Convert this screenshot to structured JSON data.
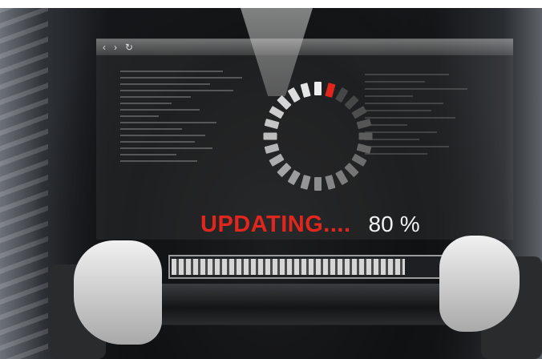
{
  "update_overlay": {
    "status_label": "UPDATING....",
    "progress_percent": 80,
    "progress_value_text": "80",
    "progress_unit": "%",
    "spinner_active_segment_color": "#e0261d",
    "status_color": "#e0261d"
  },
  "browser": {
    "back_icon": "chevron-left-icon",
    "forward_icon": "chevron-right-icon",
    "reload_icon": "reload-icon"
  }
}
